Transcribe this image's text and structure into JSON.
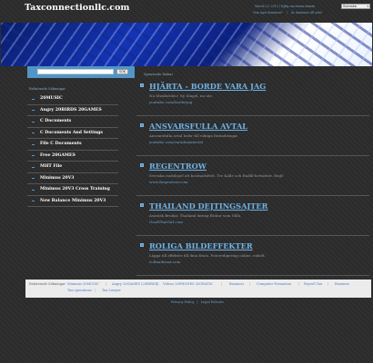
{
  "header": {
    "logo": "Taxconnectionllc.com",
    "date": "March 25, 2013 | Hjälp om denna domän",
    "language": "Svenska",
    "links": [
      "Vem äger domänen?",
      "Är domänen till salu?"
    ]
  },
  "search": {
    "button_label": "SÖK",
    "placeholder": ""
  },
  "sidebar": {
    "heading": "Relaterade Sökningar",
    "items": [
      "20MUSIC",
      "Angry 20BIRDS 20GAMES",
      "C Documents",
      "C Documents And Settings",
      "File C Documents",
      "Free 20GAMES",
      "MHT File",
      "Minimus 20V3",
      "Minimus 20V3 Cross Training",
      "New Balance Minimus 20V3"
    ]
  },
  "main": {
    "heading": "Sponsrade länkar",
    "posts": [
      {
        "title": "HJÄRTA - BORDE VARA JAG",
        "desc": "Nu Musikvideo! Ny Singel, nu ute.",
        "url": "youtube.com/borderjag"
      },
      {
        "title": "ANSVARSFULLA AVTAL",
        "desc": "Ansvarsfulla avtal leder till viktiga förändringar.",
        "url": "youtube.com/varadomatavtal"
      },
      {
        "title": "REGENTROW",
        "desc": "Svenska mobilspel att kostnadsfritt. Tre Kalle och Radlå-fortsätter. Regl!",
        "url": "www.Regentrow.com"
      },
      {
        "title": "THAILAND DEJTINGSAJTER",
        "desc": "Asiatisk Brudar, Thailand dating flickor som Gilla.",
        "url": "GoodThaiGirl.com"
      },
      {
        "title": "ROLIGA BILDEFFEKTER",
        "desc": "Lägga till effekter till dina foton. Fotoredigering online, enkelt.",
        "url": "ecBandeaux.com"
      }
    ]
  },
  "footer": {
    "row1": [
      "Relaterade Sökningar",
      "Minimus 20MUSIC",
      "Angry 20GAMES (20BIRDS)",
      "Videos 20PHONES 20GRATIS",
      "Business",
      "Computer Formation",
      "Payroll Tax",
      "Business"
    ],
    "row2": [
      "Tax operations",
      "Tax Lawyer"
    ],
    "bottom_links": [
      "Privacy Policy",
      "Legal Policies"
    ]
  }
}
